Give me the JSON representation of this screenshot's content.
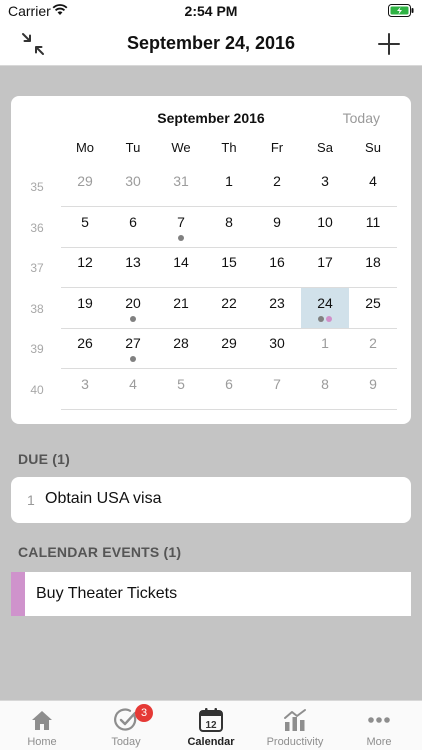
{
  "status_bar": {
    "carrier": "Carrier",
    "time": "2:54 PM"
  },
  "nav": {
    "title": "September 24, 2016",
    "collapse_icon": "collapse-arrows-icon",
    "add_icon": "plus-icon"
  },
  "calendar": {
    "month_label": "September 2016",
    "today_label": "Today",
    "weekdays": [
      "Mo",
      "Tu",
      "We",
      "Th",
      "Fr",
      "Sa",
      "Su"
    ],
    "weeks": [
      {
        "week_number": "35",
        "days": [
          {
            "label": "29",
            "muted": true
          },
          {
            "label": "30",
            "muted": true
          },
          {
            "label": "31",
            "muted": true
          },
          {
            "label": "1"
          },
          {
            "label": "2"
          },
          {
            "label": "3"
          },
          {
            "label": "4"
          }
        ]
      },
      {
        "week_number": "36",
        "days": [
          {
            "label": "5"
          },
          {
            "label": "6"
          },
          {
            "label": "7",
            "dots": [
              "#808080"
            ]
          },
          {
            "label": "8"
          },
          {
            "label": "9"
          },
          {
            "label": "10"
          },
          {
            "label": "11"
          }
        ]
      },
      {
        "week_number": "37",
        "days": [
          {
            "label": "12"
          },
          {
            "label": "13"
          },
          {
            "label": "14"
          },
          {
            "label": "15"
          },
          {
            "label": "16"
          },
          {
            "label": "17"
          },
          {
            "label": "18"
          }
        ]
      },
      {
        "week_number": "38",
        "days": [
          {
            "label": "19"
          },
          {
            "label": "20",
            "dots": [
              "#808080"
            ]
          },
          {
            "label": "21"
          },
          {
            "label": "22"
          },
          {
            "label": "23"
          },
          {
            "label": "24",
            "selected": true,
            "dots": [
              "#808080",
              "#d08fc9"
            ]
          },
          {
            "label": "25"
          }
        ]
      },
      {
        "week_number": "39",
        "days": [
          {
            "label": "26"
          },
          {
            "label": "27",
            "dots": [
              "#808080"
            ]
          },
          {
            "label": "28"
          },
          {
            "label": "29"
          },
          {
            "label": "30"
          },
          {
            "label": "1",
            "muted": true
          },
          {
            "label": "2",
            "muted": true
          }
        ]
      },
      {
        "week_number": "40",
        "days": [
          {
            "label": "3",
            "muted": true
          },
          {
            "label": "4",
            "muted": true
          },
          {
            "label": "5",
            "muted": true
          },
          {
            "label": "6",
            "muted": true
          },
          {
            "label": "7",
            "muted": true
          },
          {
            "label": "8",
            "muted": true
          },
          {
            "label": "9",
            "muted": true
          }
        ]
      }
    ]
  },
  "due": {
    "header": "DUE (1)",
    "items": [
      {
        "index": "1",
        "title": "Obtain USA visa"
      }
    ]
  },
  "events": {
    "header": "CALENDAR EVENTS (1)",
    "items": [
      {
        "title": "Buy Theater Tickets",
        "color": "#cf93cc"
      }
    ]
  },
  "tabs": [
    {
      "label": "Home",
      "icon": "home-icon"
    },
    {
      "label": "Today",
      "icon": "today-check-icon",
      "badge": "3"
    },
    {
      "label": "Calendar",
      "icon": "calendar-icon",
      "icon_text": "12",
      "active": true
    },
    {
      "label": "Productivity",
      "icon": "productivity-chart-icon"
    },
    {
      "label": "More",
      "icon": "more-dots-icon"
    }
  ],
  "colors": {
    "selected_day": "#d1e1ea",
    "badge": "#e53935",
    "event_dot_default": "#808080"
  }
}
